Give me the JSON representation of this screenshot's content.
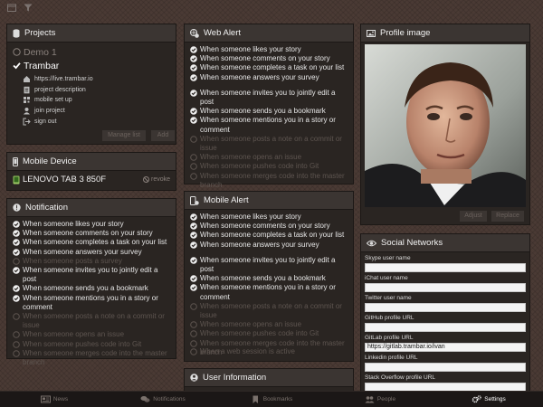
{
  "colors": {
    "background": "#4a3a34",
    "panel": "#2a2522",
    "panel_header": "#3b3532",
    "text": "#e8e8e8",
    "disabled_text": "#5e5550"
  },
  "projects": {
    "title": "Projects",
    "items": [
      {
        "name": "Demo 1",
        "selected": false
      },
      {
        "name": "Trambar",
        "selected": true
      }
    ],
    "links": [
      {
        "label": "https://live.trambar.io",
        "icon": "home-icon"
      },
      {
        "label": "project description",
        "icon": "description-icon"
      },
      {
        "label": "mobile set up",
        "icon": "qr-code-icon"
      },
      {
        "label": "join project",
        "icon": "user-icon"
      },
      {
        "label": "sign out",
        "icon": "sign-out-icon"
      }
    ],
    "manage_label": "Manage list",
    "add_label": "Add"
  },
  "mobile_device": {
    "title": "Mobile Device",
    "device_name": "LENOVO TAB 3 850F",
    "revoke_label": "revoke"
  },
  "notification": {
    "title": "Notification",
    "items": [
      {
        "label": "When someone likes your story",
        "on": true
      },
      {
        "label": "When someone comments on your story",
        "on": true
      },
      {
        "label": "When someone completes a task on your list",
        "on": true
      },
      {
        "label": "When someone answers your survey",
        "on": true
      },
      {
        "label": "When someone posts a survey",
        "on": false
      },
      {
        "label": "When someone invites you to jointly edit a post",
        "on": true
      },
      {
        "label": "When someone sends you a bookmark",
        "on": true
      },
      {
        "label": "When someone mentions you in a story or comment",
        "on": true
      },
      {
        "label": "When someone posts a note on a commit or issue",
        "on": false
      },
      {
        "label": "When someone opens an issue",
        "on": false
      },
      {
        "label": "When someone pushes code into Git",
        "on": false
      },
      {
        "label": "When someone merges code into the master branch",
        "on": false
      }
    ]
  },
  "web_alert": {
    "title": "Web Alert",
    "items": [
      {
        "label": "When someone likes your story",
        "on": true
      },
      {
        "label": "When someone comments on your story",
        "on": true
      },
      {
        "label": "When someone completes a task on your list",
        "on": true
      },
      {
        "label": "When someone answers your survey",
        "on": true
      },
      {
        "label": "When someone invites you to jointly edit a post",
        "on": true
      },
      {
        "label": "When someone sends you a bookmark",
        "on": true
      },
      {
        "label": "When someone mentions you in a story or comment",
        "on": true
      },
      {
        "label": "When someone posts a note on a commit or issue",
        "on": false
      },
      {
        "label": "When someone opens an issue",
        "on": false
      },
      {
        "label": "When someone pushes code into Git",
        "on": false
      },
      {
        "label": "When someone merges code into the master branch",
        "on": false
      }
    ]
  },
  "mobile_alert": {
    "title": "Mobile Alert",
    "items": [
      {
        "label": "When someone likes your story",
        "on": true
      },
      {
        "label": "When someone comments on your story",
        "on": true
      },
      {
        "label": "When someone completes a task on your list",
        "on": true
      },
      {
        "label": "When someone answers your survey",
        "on": true
      },
      {
        "label": "When someone invites you to jointly edit a post",
        "on": true
      },
      {
        "label": "When someone sends you a bookmark",
        "on": true
      },
      {
        "label": "When someone mentions you in a story or comment",
        "on": true
      },
      {
        "label": "When someone posts a note on a commit or issue",
        "on": false
      },
      {
        "label": "When someone opens an issue",
        "on": false
      },
      {
        "label": "When someone pushes code into Git",
        "on": false
      },
      {
        "label": "When someone merges code into the master branch",
        "on": false
      }
    ],
    "web_session_label": "When a web session is active"
  },
  "user_information": {
    "title": "User Information"
  },
  "profile_image": {
    "title": "Profile image",
    "adjust_label": "Adjust",
    "replace_label": "Replace"
  },
  "social_networks": {
    "title": "Social Networks",
    "fields": [
      {
        "label": "Skype user name",
        "value": ""
      },
      {
        "label": "iChat user name",
        "value": ""
      },
      {
        "label": "Twitter user name",
        "value": ""
      },
      {
        "label": "GitHub profile URL",
        "value": ""
      },
      {
        "label": "GitLab profile URL",
        "value": "https://gitlab.trambar.io/ivan"
      },
      {
        "label": "Linkedin profile URL",
        "value": ""
      },
      {
        "label": "Stack Overflow profile URL",
        "value": ""
      }
    ]
  },
  "bottom_nav": {
    "tabs": [
      {
        "label": "News",
        "icon": "newspaper-icon",
        "active": false
      },
      {
        "label": "Notifications",
        "icon": "comments-icon",
        "active": false
      },
      {
        "label": "Bookmarks",
        "icon": "bookmark-icon",
        "active": false
      },
      {
        "label": "People",
        "icon": "people-icon",
        "active": false
      },
      {
        "label": "Settings",
        "icon": "gears-icon",
        "active": true
      }
    ]
  }
}
